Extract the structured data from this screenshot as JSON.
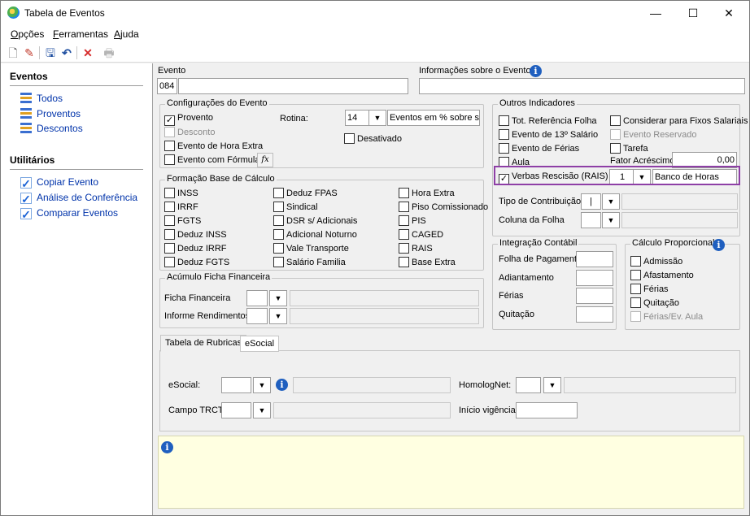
{
  "window": {
    "title": "Tabela de Eventos",
    "minimize": "—",
    "maximize": "☐",
    "close": "✕"
  },
  "menu": {
    "opcoes_first": "O",
    "opcoes_rest": "pções",
    "ferramentas_first": "F",
    "ferramentas_rest": "erramentas",
    "ajuda_first": "A",
    "ajuda_rest": "juda"
  },
  "toolbar": {
    "new": "🗋",
    "edit": "✎",
    "save": "🖫",
    "undo": "↶",
    "delete": "✕",
    "print": "🖶"
  },
  "sidebar": {
    "eventos_title": "Eventos",
    "eventos_items": [
      "Todos",
      "Proventos",
      "Descontos"
    ],
    "utilitarios_title": "Utilitários",
    "utilitarios_items": [
      "Copiar Evento",
      "Análise de Conferência",
      "Comparar Eventos"
    ]
  },
  "evento": {
    "label": "Evento",
    "code": "084",
    "name": "",
    "info_label": "Informações sobre o Evento",
    "info_value": ""
  },
  "config": {
    "title": "Configurações do Evento",
    "provento": "Provento",
    "desconto": "Desconto",
    "hora_extra": "Evento de Hora Extra",
    "formula": "Evento com Fórmula",
    "fx": "fx",
    "rotina_label": "Rotina:",
    "rotina_value": "14",
    "rotina_desc": "Eventos em % sobre sal",
    "desativado": "Desativado"
  },
  "formacao": {
    "title": "Formação Base de Cálculo",
    "col1": [
      "INSS",
      "IRRF",
      "FGTS",
      "Deduz INSS",
      "Deduz IRRF",
      "Deduz FGTS"
    ],
    "col2": [
      "Deduz FPAS",
      "Sindical",
      "DSR s/ Adicionais",
      "Adicional Noturno",
      "Vale Transporte",
      "Salário Familia"
    ],
    "col3": [
      "Hora Extra",
      "Piso Comissionado",
      "PIS",
      "CAGED",
      "RAIS",
      "Base Extra"
    ]
  },
  "acumulo": {
    "title": "Acúmulo Ficha Financeira",
    "ficha_label": "Ficha Financeira",
    "informe_label": "Informe Rendimentos"
  },
  "outros": {
    "title": "Outros Indicadores",
    "tot_ref": "Tot. Referência Folha",
    "considerar": "Considerar para Fixos Salariais",
    "decimo": "Evento de 13º Salário",
    "reservado": "Evento Reservado",
    "ferias": "Evento de Férias",
    "tarefa": "Tarefa",
    "aula": "Aula",
    "fator_label": "Fator Acréscimo",
    "fator_value": "0,00",
    "verbas": "Verbas Rescisão (RAIS)",
    "verbas_value": "1",
    "verbas_desc": "Banco de Horas",
    "tipo_contrib": "Tipo de Contribuição",
    "coluna_folha": "Coluna da Folha"
  },
  "integracao": {
    "title": "Integração Contábil",
    "folha": "Folha de Pagamento",
    "adiantamento": "Adiantamento",
    "ferias": "Férias",
    "quitacao": "Quitação"
  },
  "proporcional": {
    "title": "Cálculo Proporcional",
    "admissao": "Admissão",
    "afastamento": "Afastamento",
    "ferias": "Férias",
    "quitacao": "Quitação",
    "ferias_aula": "Férias/Ev. Aula"
  },
  "tabs": {
    "rubricas": "Tabela de Rubricas",
    "esocial": "eSocial"
  },
  "rubricas": {
    "esocial_label": "eSocial:",
    "homolog_label": "HomologNet:",
    "trct_label": "Campo TRCT:",
    "inicio_label": "Início vigência:"
  },
  "info_icon": "i",
  "combo_arrow": "▼",
  "colors": {
    "highlight": "#8e3fa6",
    "message_bg": "#ffffe1",
    "link": "#0033aa"
  }
}
